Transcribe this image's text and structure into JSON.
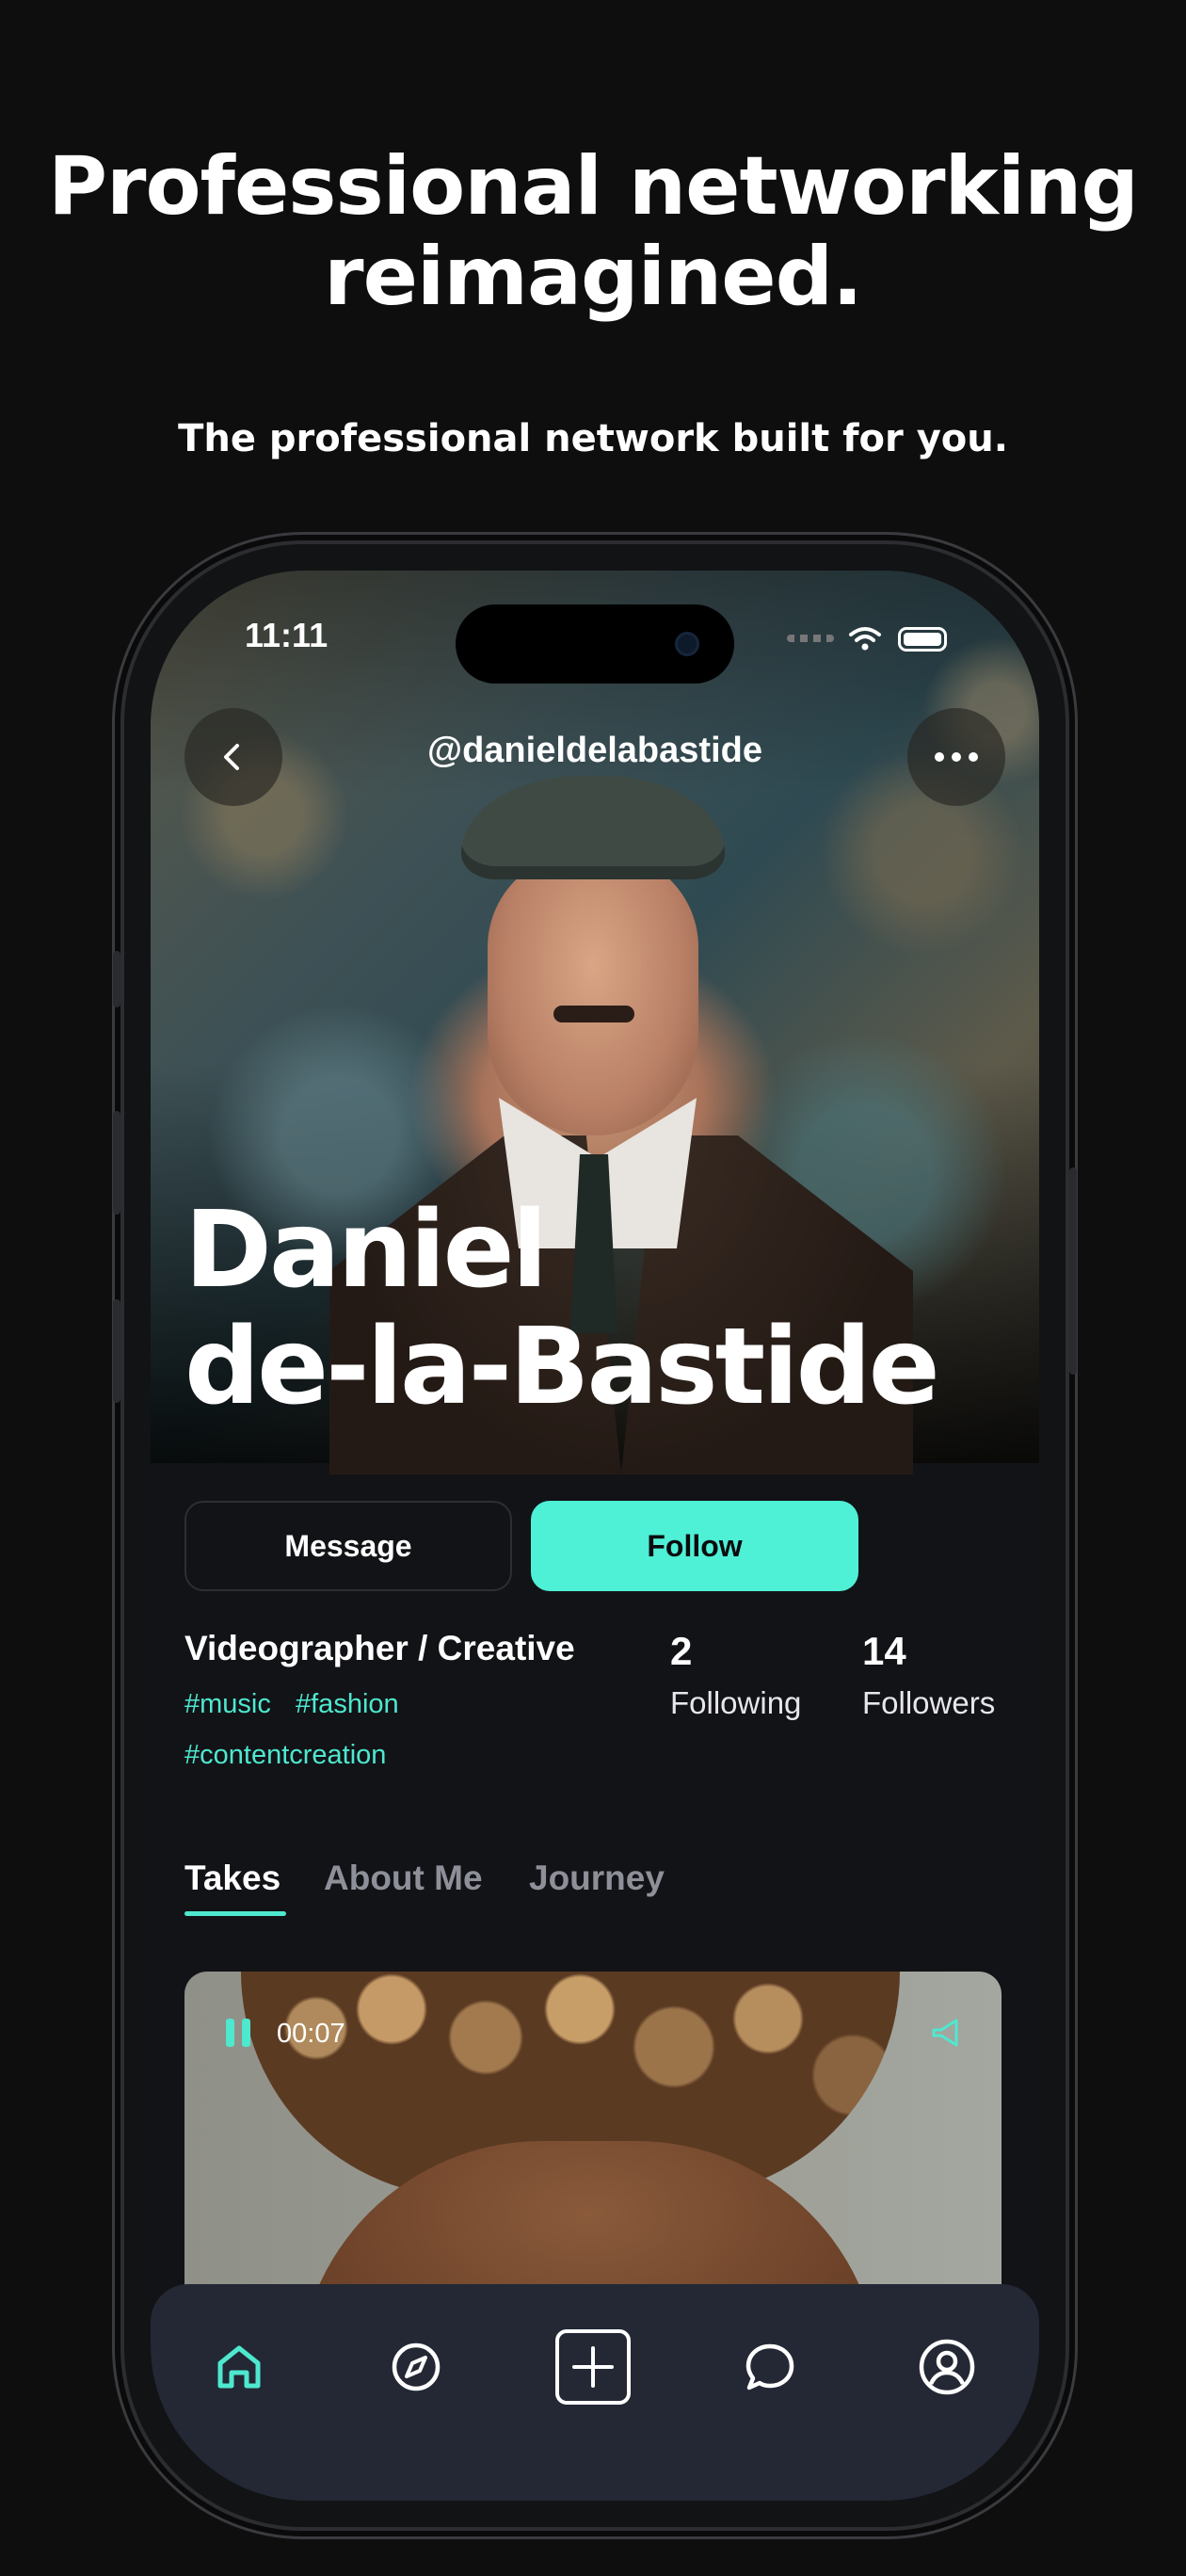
{
  "promo": {
    "headline_line1": "Professional networking",
    "headline_line2": "reimagined.",
    "subline": "The professional network built for you."
  },
  "status_bar": {
    "time": "11:11"
  },
  "profile": {
    "handle": "@danieldelabastide",
    "name_line1": "Daniel",
    "name_line2": "de-la-Bastide",
    "role": "Videographer / Creative",
    "tags": [
      "#music",
      "#fashion",
      "#contentcreation"
    ],
    "stats": {
      "following_count": "2",
      "following_label": "Following",
      "followers_count": "14",
      "followers_label": "Followers"
    }
  },
  "actions": {
    "message_label": "Message",
    "follow_label": "Follow"
  },
  "tabs": [
    {
      "label": "Takes",
      "active": true
    },
    {
      "label": "About Me",
      "active": false
    },
    {
      "label": "Journey",
      "active": false
    }
  ],
  "video": {
    "time": "00:07"
  },
  "bottom_nav": {
    "items": [
      "home-icon",
      "compass-icon",
      "add-icon",
      "chat-icon",
      "profile-icon"
    ],
    "active": "home-icon"
  },
  "colors": {
    "accent": "#4ef0d6",
    "background": "#0e0e0f",
    "nav_background": "#232834",
    "inactive_icon": "#ffffff"
  }
}
